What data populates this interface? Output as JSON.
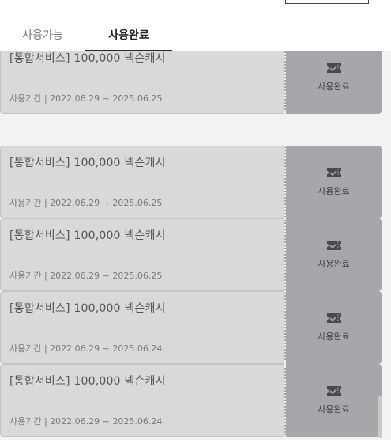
{
  "tabs": [
    {
      "label": "사용가능"
    },
    {
      "label": "사용완료"
    }
  ],
  "coupons": [
    {
      "title": "[통합서비스] 100,000 넥슨캐시",
      "period": "사용기간 | 2022.06.29 ~ 2025.06.25",
      "status": "사용완료"
    },
    {
      "title": "[통합서비스] 100,000 넥슨캐시",
      "period": "사용기간 | 2022.06.29 ~ 2025.06.25",
      "status": "사용완료"
    },
    {
      "title": "[통합서비스] 100,000 넥슨캐시",
      "period": "사용기간 | 2022.06.29 ~ 2025.06.25",
      "status": "사용완료"
    },
    {
      "title": "[통합서비스] 100,000 넥슨캐시",
      "period": "사용기간 | 2022.06.29 ~ 2025.06.24",
      "status": "사용완료"
    },
    {
      "title": "[통합서비스] 100,000 넥슨캐시",
      "period": "사용기간 | 2022.06.29 ~ 2025.06.24",
      "status": "사용완료"
    }
  ],
  "icons": {
    "stub": "ticket-check-icon"
  },
  "colors": {
    "coupon_bg": "#d9d9d9",
    "stub_bg": "#a7a7ab",
    "active_tab_underline": "#2b2b2b"
  }
}
